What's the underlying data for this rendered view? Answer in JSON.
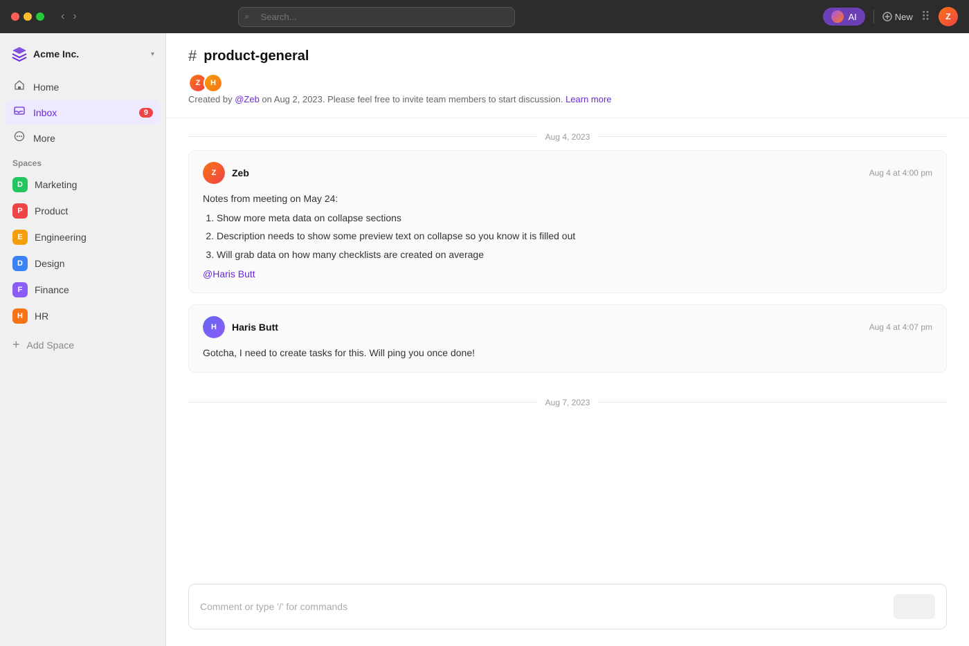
{
  "titlebar": {
    "search_placeholder": "Search...",
    "ai_label": "AI",
    "new_label": "New"
  },
  "sidebar": {
    "workspace_name": "Acme Inc.",
    "nav_items": [
      {
        "id": "home",
        "label": "Home",
        "icon": "🏠",
        "active": false
      },
      {
        "id": "inbox",
        "label": "Inbox",
        "icon": "📥",
        "active": true,
        "badge": "9"
      },
      {
        "id": "more",
        "label": "More",
        "icon": "⊙",
        "active": false
      }
    ],
    "spaces_label": "Spaces",
    "spaces": [
      {
        "id": "marketing",
        "label": "Marketing",
        "letter": "D",
        "color": "#22c55e"
      },
      {
        "id": "product",
        "label": "Product",
        "letter": "P",
        "color": "#ef4444"
      },
      {
        "id": "engineering",
        "label": "Engineering",
        "letter": "E",
        "color": "#f59e0b"
      },
      {
        "id": "design",
        "label": "Design",
        "letter": "D",
        "color": "#3b82f6"
      },
      {
        "id": "finance",
        "label": "Finance",
        "letter": "F",
        "color": "#8b5cf6"
      },
      {
        "id": "hr",
        "label": "HR",
        "letter": "H",
        "color": "#f97316"
      }
    ],
    "add_space_label": "Add Space"
  },
  "channel": {
    "hash": "#",
    "name": "product-general",
    "description_prefix": "Created by ",
    "description_creator": "@Zeb",
    "description_suffix": " on Aug 2, 2023. Please feel free to invite team members to start discussion. ",
    "learn_more": "Learn more"
  },
  "messages": {
    "date_group_1": "Aug 4, 2023",
    "date_group_2": "Aug 7, 2023",
    "items": [
      {
        "id": "msg1",
        "author": "Zeb",
        "time": "Aug 4 at 4:00 pm",
        "avatar_color": "#f97316",
        "body_prefix": "Notes from meeting on May 24:",
        "list_items": [
          "Show more meta data on collapse sections",
          "Description needs to show some preview text on collapse so you know it is filled out",
          "Will grab data on how many checklists are created on average"
        ],
        "mention": "@Haris Butt"
      },
      {
        "id": "msg2",
        "author": "Haris Butt",
        "time": "Aug 4 at 4:07 pm",
        "avatar_color": "#6366f1",
        "body": "Gotcha, I need to create tasks for this. Will ping you once done!"
      }
    ]
  },
  "comment_input": {
    "placeholder": "Comment or type '/' for commands"
  }
}
